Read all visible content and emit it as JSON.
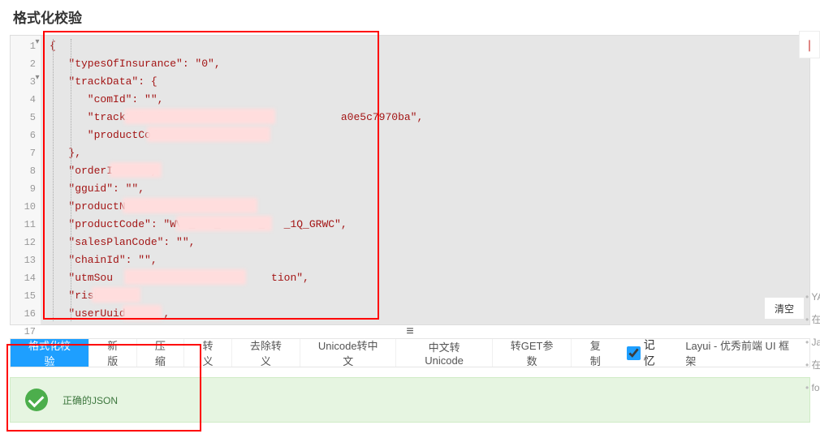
{
  "header": {
    "title": "格式化校验"
  },
  "editor": {
    "clear_label": "清空",
    "lines": [
      "{",
      "   \"typesOfInsurance\": \"0\",",
      "   \"trackData\": {",
      "      \"comId\": \"\",",
      "      \"trackId\": \"                            a0e5c7970ba\",",
      "      \"productCode",
      "   },",
      "   \"orderId\": \"\",",
      "   \"gguid\": \"\",",
      "   \"productName\"",
      "   \"productCode\": \"WVB_   _      _   _1Q_GRWC\",",
      "   \"salesPlanCode\": \"\",",
      "   \"chainId\": \"\",",
      "   \"utmSou                         tion\",",
      "   \"riskCod",
      "   \"userUuid  :   ,",
      ""
    ]
  },
  "toolbar": {
    "buttons": [
      {
        "label": "格式化校验",
        "active": true
      },
      {
        "label": "新版",
        "active": false
      },
      {
        "label": "压缩",
        "active": false
      },
      {
        "label": "转义",
        "active": false
      },
      {
        "label": "去除转义",
        "active": false
      },
      {
        "label": "Unicode转中文",
        "active": false
      },
      {
        "label": "中文转Unicode",
        "active": false
      },
      {
        "label": "转GET参数",
        "active": false
      },
      {
        "label": "复制",
        "active": false
      }
    ],
    "memory_label": "记忆",
    "memory_checked": true,
    "layui_label": "Layui - 优秀前端 UI 框架"
  },
  "result": {
    "message": "正确的JSON"
  },
  "sidebar": {
    "items": [
      "YA",
      "在",
      "Ja",
      "在",
      "fo"
    ]
  }
}
